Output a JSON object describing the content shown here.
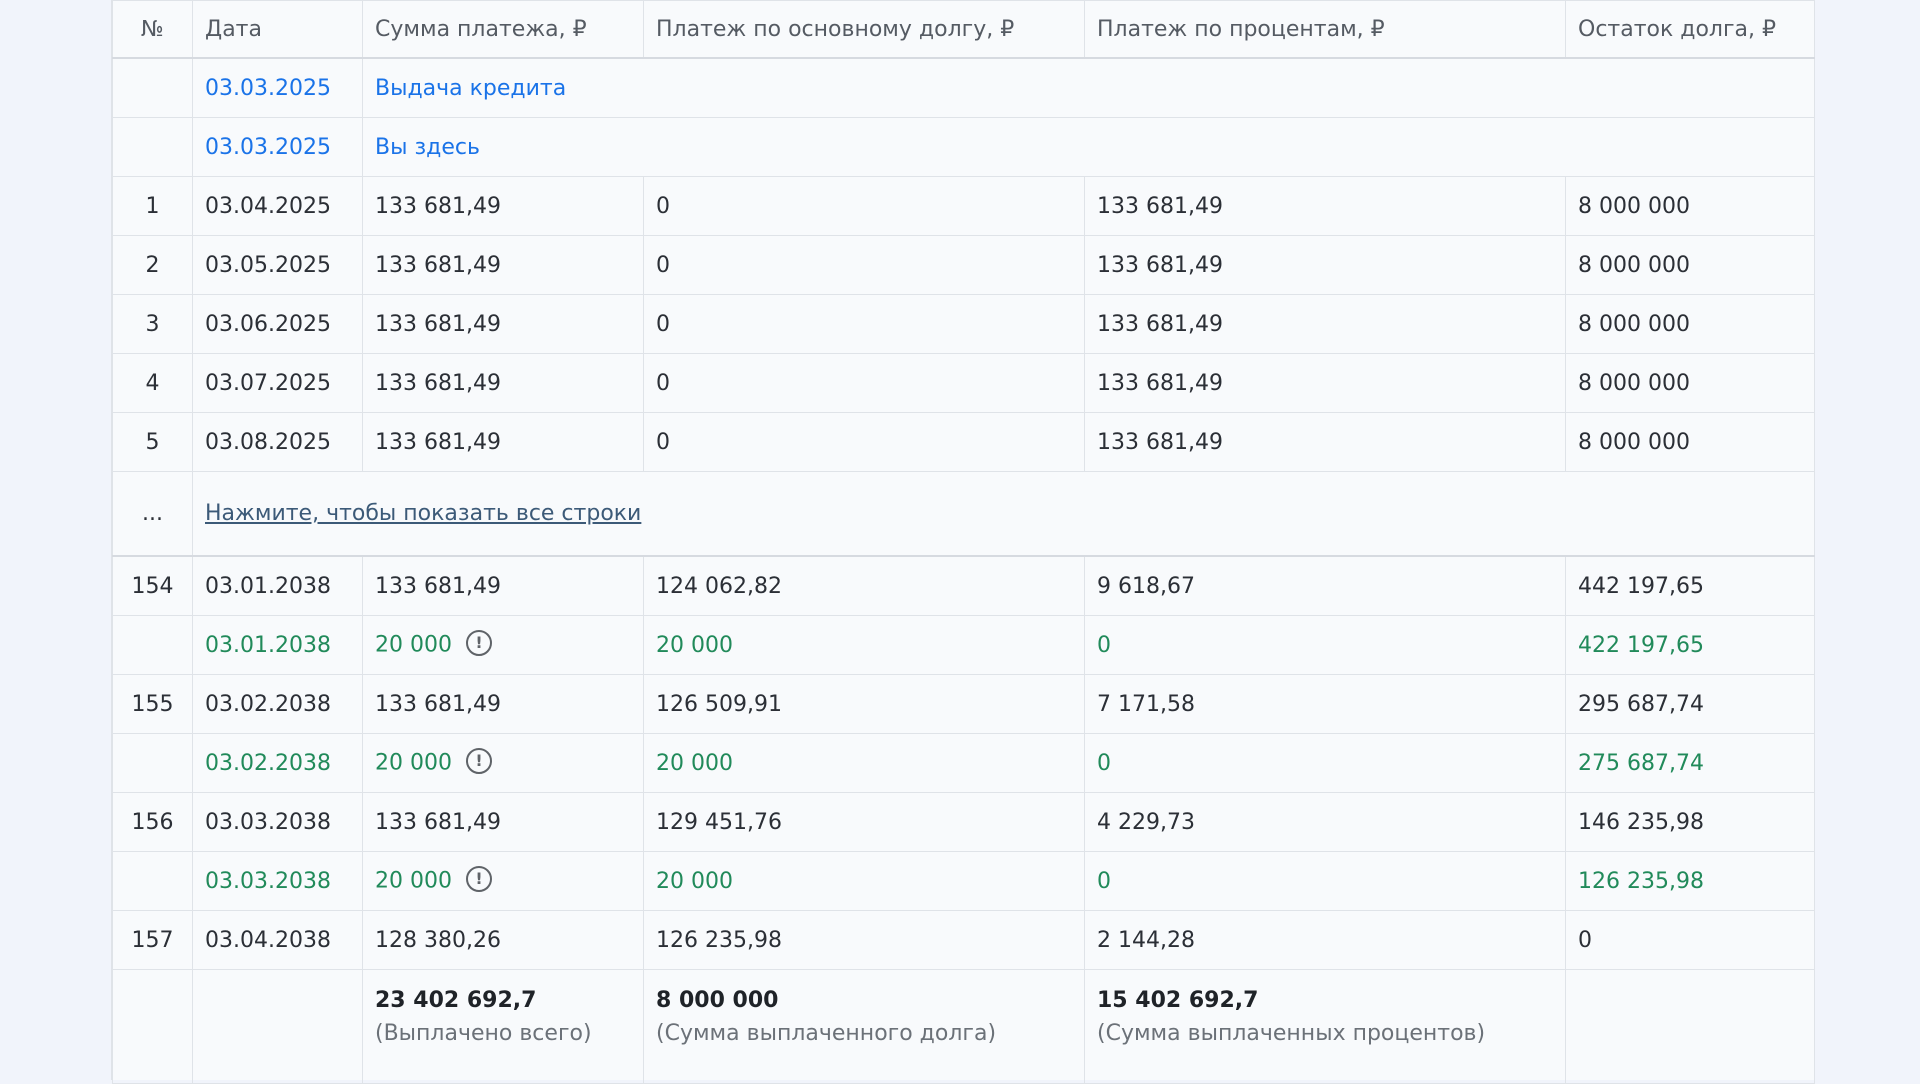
{
  "table": {
    "headers": [
      "№",
      "Дата",
      "Сумма платежа, ₽",
      "Платеж по основному долгу, ₽",
      "Платеж по процентам, ₽",
      "Остаток долга, ₽"
    ],
    "event_rows": [
      {
        "date": "03.03.2025",
        "label": "Выдача кредита"
      },
      {
        "date": "03.03.2025",
        "label": "Вы здесь"
      }
    ],
    "rows_top": [
      {
        "no": "1",
        "date": "03.04.2025",
        "sum": "133 681,49",
        "principal": "0",
        "interest": "133 681,49",
        "balance": "8 000 000"
      },
      {
        "no": "2",
        "date": "03.05.2025",
        "sum": "133 681,49",
        "principal": "0",
        "interest": "133 681,49",
        "balance": "8 000 000"
      },
      {
        "no": "3",
        "date": "03.06.2025",
        "sum": "133 681,49",
        "principal": "0",
        "interest": "133 681,49",
        "balance": "8 000 000"
      },
      {
        "no": "4",
        "date": "03.07.2025",
        "sum": "133 681,49",
        "principal": "0",
        "interest": "133 681,49",
        "balance": "8 000 000"
      },
      {
        "no": "5",
        "date": "03.08.2025",
        "sum": "133 681,49",
        "principal": "0",
        "interest": "133 681,49",
        "balance": "8 000 000"
      }
    ],
    "expand_row": {
      "no": "...",
      "label": "Нажмите, чтобы показать все строки"
    },
    "rows_bottom": [
      {
        "no": "154",
        "date": "03.01.2038",
        "sum": "133 681,49",
        "principal": "124 062,82",
        "interest": "9 618,67",
        "balance": "442 197,65"
      },
      {
        "date": "03.01.2038",
        "sum": "20 000",
        "principal": "20 000",
        "interest": "0",
        "balance": "422 197,65",
        "icon": "exclamation-circle-icon"
      },
      {
        "no": "155",
        "date": "03.02.2038",
        "sum": "133 681,49",
        "principal": "126 509,91",
        "interest": "7 171,58",
        "balance": "295 687,74"
      },
      {
        "date": "03.02.2038",
        "sum": "20 000",
        "principal": "20 000",
        "interest": "0",
        "balance": "275 687,74",
        "icon": "exclamation-circle-icon"
      },
      {
        "no": "156",
        "date": "03.03.2038",
        "sum": "133 681,49",
        "principal": "129 451,76",
        "interest": "4 229,73",
        "balance": "146 235,98"
      },
      {
        "date": "03.03.2038",
        "sum": "20 000",
        "principal": "20 000",
        "interest": "0",
        "balance": "126 235,98",
        "icon": "exclamation-circle-icon"
      },
      {
        "no": "157",
        "date": "03.04.2038",
        "sum": "128 380,26",
        "principal": "126 235,98",
        "interest": "2 144,28",
        "balance": "0"
      }
    ],
    "totals": {
      "sum": "23 402 692,7",
      "sum_caption": "(Выплачено всего)",
      "principal": "8 000 000",
      "principal_caption": "(Сумма выплаченного долга)",
      "interest": "15 402 692,7",
      "interest_caption": "(Сумма выплаченных процентов)"
    }
  },
  "colors": {
    "event_text": "#1a73e8",
    "extra_payment_text": "#218a5a",
    "link_text": "#3c5a78"
  }
}
